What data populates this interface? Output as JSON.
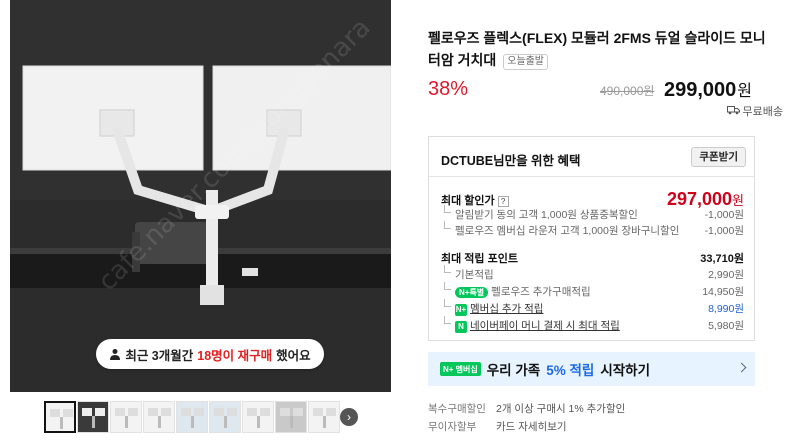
{
  "gallery": {
    "rebuy_badge": {
      "prefix": "최근 3개월간",
      "highlight": "18명이 재구매",
      "suffix": "했어요"
    },
    "thumbnail_count": 9
  },
  "product": {
    "title": "펠로우즈 플렉스(FLEX) 모듈러 2FMS 듀얼 슬라이드 모니터암 거치대",
    "today_tag": "오늘출발",
    "discount_rate": "38%",
    "original_price": "490,000원",
    "sale_price": "299,000",
    "currency": "원",
    "shipping": "무료배송"
  },
  "benefits": {
    "header": "DCTUBE님만을 위한 혜택",
    "coupon_button": "쿠폰받기",
    "max_discount_label": "최대 할인가",
    "help_mark": "?",
    "max_discount_value": "297,000",
    "max_discount_currency": "원",
    "discount_items": [
      {
        "label": "알림받기 동의 고객 1,000원 상품중복할인",
        "value": "-1,000원"
      },
      {
        "label": "펠로우즈 멤버십 라운저 고객 1,000원 장바구니할인",
        "value": "-1,000원"
      }
    ],
    "points_label": "최대 적립 포인트",
    "points_value": "33,710원",
    "point_items": [
      {
        "badge": "",
        "label": "기본적립",
        "value": "2,990원"
      },
      {
        "badge": "N+특별",
        "label": "펠로우즈 추가구매적립",
        "value": "14,950원"
      },
      {
        "badge": "N+",
        "label": "멤버십 추가 적립",
        "value": "8,990원"
      },
      {
        "badge": "N",
        "label": "네이버페이 머니 결제 시 최대 적립",
        "value": "5,980원"
      }
    ]
  },
  "promo": {
    "badge": "N+ 멤버십",
    "text_prefix": "우리 가족",
    "text_highlight": "5% 적립",
    "text_suffix": "시작하기"
  },
  "extra_info": [
    {
      "label": "복수구매할인",
      "value": "2개 이상 구매시 1% 추가할인"
    },
    {
      "label": "무이자할부",
      "value": "카드 자세히보기"
    }
  ],
  "colors": {
    "discount_red": "#e0182d",
    "naver_green": "#03c75a",
    "highlight_blue": "#1b69e6"
  }
}
